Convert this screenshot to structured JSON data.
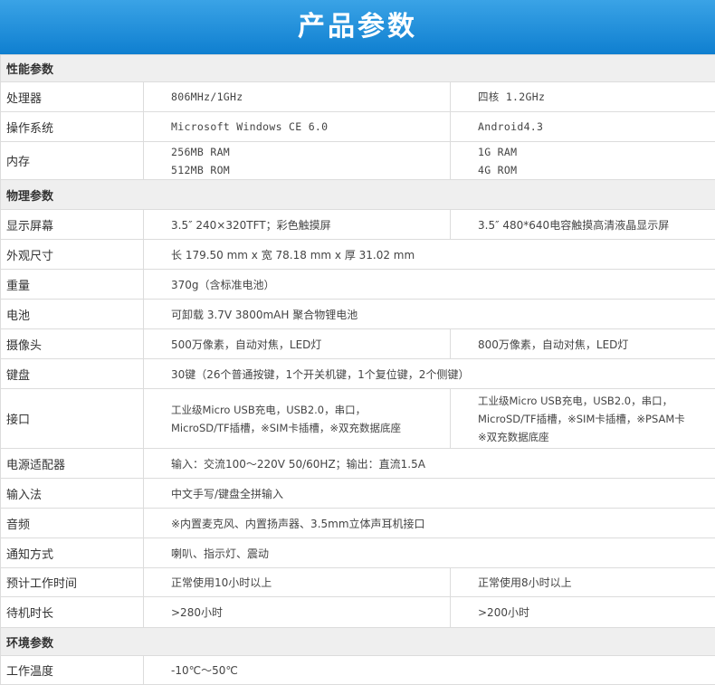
{
  "title": "产品参数",
  "sections": {
    "performance": "性能参数",
    "physical": "物理参数",
    "environment": "环境参数"
  },
  "rows": {
    "cpu": {
      "label": "处理器",
      "a": "806MHz/1GHz",
      "b": "四核 1.2GHz"
    },
    "os": {
      "label": "操作系统",
      "a": "Microsoft Windows CE 6.0",
      "b": "Android4.3"
    },
    "memory": {
      "label": "内存",
      "a1": "256MB RAM",
      "a2": "512MB ROM",
      "b1": "1G RAM",
      "b2": "4G ROM"
    },
    "display": {
      "label": "显示屏幕",
      "a": "3.5″ 240×320TFT；彩色触摸屏",
      "b": "3.5″ 480*640电容触摸高清液晶显示屏"
    },
    "size": {
      "label": "外观尺寸",
      "a": "长 179.50 mm x 宽 78.18 mm x 厚 31.02 mm"
    },
    "weight": {
      "label": "重量",
      "a": "370g（含标准电池）"
    },
    "battery": {
      "label": "电池",
      "a": "可卸载 3.7V 3800mAH 聚合物锂电池"
    },
    "camera": {
      "label": "摄像头",
      "a": "500万像素，自动对焦，LED灯",
      "b": "800万像素，自动对焦，LED灯"
    },
    "keyboard": {
      "label": "键盘",
      "a": "30键（26个普通按键，1个开关机键，1个复位键，2个侧键）"
    },
    "interface": {
      "label": "接口",
      "a1": "工业级Micro USB充电，USB2.0，串口，",
      "a2": "MicroSD/TF插槽，※SIM卡插槽，※双充数据底座",
      "b1": "工业级Micro USB充电，USB2.0，串口，",
      "b2": "MicroSD/TF插槽，※SIM卡插槽，※PSAM卡",
      "b3": "※双充数据底座"
    },
    "adapter": {
      "label": "电源适配器",
      "a": "输入：交流100～220V 50/60HZ；输出：直流1.5A"
    },
    "input": {
      "label": "输入法",
      "a": "中文手写/键盘全拼输入"
    },
    "audio": {
      "label": "音频",
      "a": "※内置麦克风、内置扬声器、3.5mm立体声耳机接口"
    },
    "notify": {
      "label": "通知方式",
      "a": "喇叭、指示灯、震动"
    },
    "worktime": {
      "label": "预计工作时间",
      "a": "正常使用10小时以上",
      "b": "正常使用8小时以上"
    },
    "standby": {
      "label": "待机时长",
      "a": ">280小时",
      "b": ">200小时"
    },
    "temp": {
      "label": "工作温度",
      "a": "-10℃～50℃"
    }
  }
}
